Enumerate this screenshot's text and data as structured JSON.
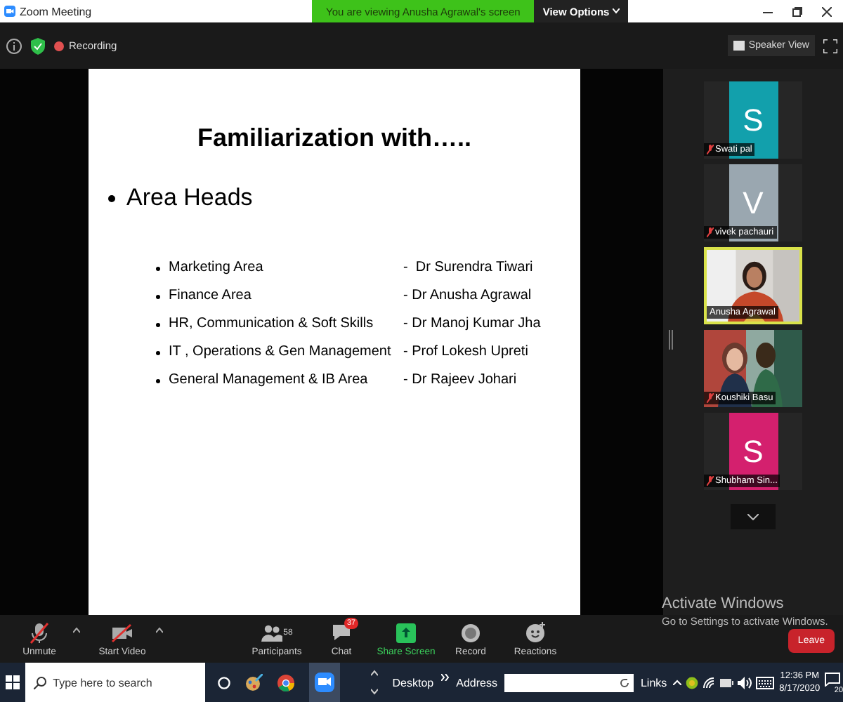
{
  "window": {
    "title": "Zoom Meeting"
  },
  "share_banner": {
    "text": "You are viewing Anusha Agrawal's screen",
    "view_options": "View Options"
  },
  "meeting_bar": {
    "recording": "Recording",
    "view_button": "Speaker View"
  },
  "slide": {
    "title": "Familiarization with…..",
    "heading": "Area Heads",
    "items": [
      {
        "area": "Marketing Area",
        "head": "-  Dr Surendra Tiwari"
      },
      {
        "area": "Finance Area",
        "head": "- Dr Anusha Agrawal"
      },
      {
        "area": "HR, Communication & Soft Skills",
        "head": "- Dr Manoj Kumar Jha"
      },
      {
        "area": "IT , Operations & Gen Management",
        "head": "- Prof Lokesh Upreti"
      },
      {
        "area": "General Management & IB Area",
        "head": "- Dr Rajeev Johari"
      }
    ]
  },
  "participants": [
    {
      "name": "Swati pal",
      "kind": "avatar",
      "initial": "S",
      "color": "#12a0ac",
      "muted": true,
      "selected": false
    },
    {
      "name": "vivek pachauri",
      "kind": "avatar",
      "initial": "V",
      "color": "#9aa7b0",
      "muted": true,
      "selected": false
    },
    {
      "name": "Anusha Agrawal",
      "kind": "video",
      "muted": false,
      "selected": true
    },
    {
      "name": "Koushiki Basu",
      "kind": "video",
      "muted": true,
      "selected": false
    },
    {
      "name": "Shubham Sin...",
      "kind": "avatar",
      "initial": "S",
      "color": "#d4206e",
      "muted": true,
      "selected": false
    }
  ],
  "activation_notice": {
    "title": "Activate Windows",
    "text": "Go to Settings to activate Windows."
  },
  "controls": [
    {
      "kind": "mic",
      "label": "Unmute"
    },
    {
      "kind": "video",
      "label": "Start Video"
    },
    {
      "kind": "participants",
      "label": "Participants",
      "count": "58"
    },
    {
      "kind": "chat",
      "label": "Chat",
      "badge": "37"
    },
    {
      "kind": "share",
      "label": "Share Screen"
    },
    {
      "kind": "record",
      "label": "Record"
    },
    {
      "kind": "reactions",
      "label": "Reactions"
    }
  ],
  "leave": "Leave",
  "taskbar": {
    "search_placeholder": "Type here to search",
    "toolbar": "Desktop",
    "address_label": "Address",
    "links": "Links",
    "time": "12:36 PM",
    "date": "8/17/2020",
    "notifications": "20"
  }
}
